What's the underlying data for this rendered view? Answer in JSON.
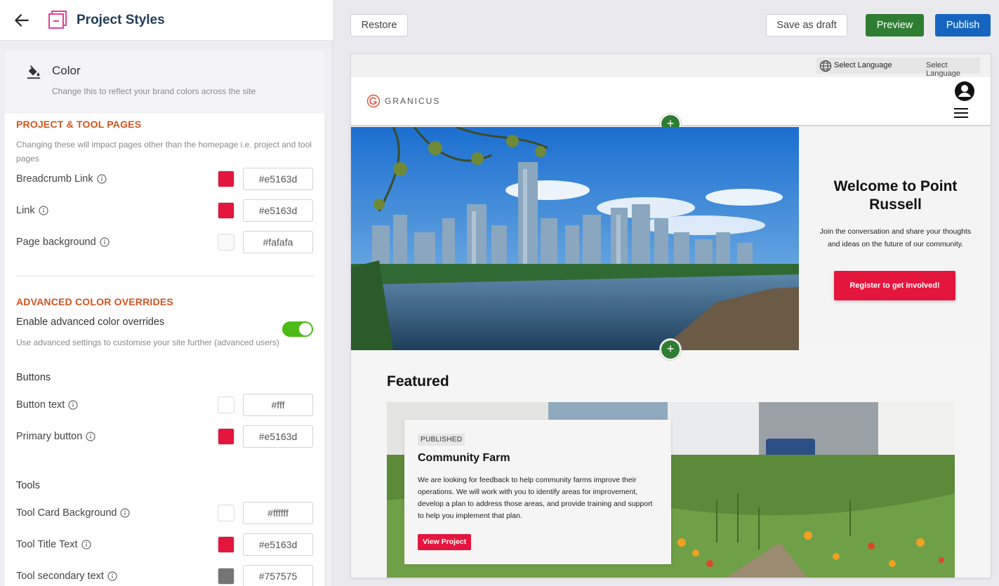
{
  "header": {
    "title": "Project Styles",
    "back_icon": "arrow-left-icon",
    "brand_icon": "project-styles-icon"
  },
  "color_section": {
    "title": "Color",
    "subtitle": "Change this to reflect your brand colors across the site",
    "icon": "paint-bucket-icon"
  },
  "project_tool_pages": {
    "heading": "PROJECT & TOOL PAGES",
    "description": "Changing these will impact pages other than the homepage i.e. project and tool pages",
    "rows": [
      {
        "label": "Breadcrumb Link",
        "value": "#e5163d",
        "color": "#e5163d"
      },
      {
        "label": "Link",
        "value": "#e5163d",
        "color": "#e5163d"
      },
      {
        "label": "Page background",
        "value": "#fafafa",
        "color": "#fafafa"
      }
    ]
  },
  "advanced": {
    "heading": "ADVANCED COLOR OVERRIDES",
    "toggle_label": "Enable advanced color overrides",
    "toggle_on": true,
    "description": "Use advanced settings to customise your site further (advanced users)",
    "buttons_heading": "Buttons",
    "buttons": [
      {
        "label": "Button text",
        "value": "#fff",
        "color": "#ffffff"
      },
      {
        "label": "Primary button",
        "value": "#e5163d",
        "color": "#e5163d"
      }
    ],
    "tools_heading": "Tools",
    "tools": [
      {
        "label": "Tool Card Background",
        "value": "#ffffff",
        "color": "#ffffff"
      },
      {
        "label": "Tool Title Text",
        "value": "#e5163d",
        "color": "#e5163d"
      },
      {
        "label": "Tool secondary text",
        "value": "#757575",
        "color": "#757575"
      }
    ]
  },
  "toolbar": {
    "restore": "Restore",
    "save_draft": "Save as draft",
    "preview": "Preview",
    "publish": "Publish"
  },
  "preview": {
    "language_label": "Select Language",
    "language_label_2": "Select Language",
    "logo_text": "GRANICUS",
    "hero_title": "Welcome to Point Russell",
    "hero_text": "Join the conversation and share your thoughts and ideas on the future of our community.",
    "hero_button": "Register to get involved!",
    "featured_heading": "Featured",
    "card_badge": "PUBLISHED",
    "card_title": "Community Farm",
    "card_text": "We are looking for feedback to help community farms improve their operations. We will work with you to identify areas for improvement, develop a plan to address those areas, and provide training and support to help you implement that plan.",
    "card_button": "View Project",
    "add_section_icon": "plus-icon"
  },
  "colors": {
    "accent": "#e5163d",
    "preview_green": "#2e7d32",
    "publish_blue": "#1565c0",
    "section_heading": "#d0541e"
  }
}
